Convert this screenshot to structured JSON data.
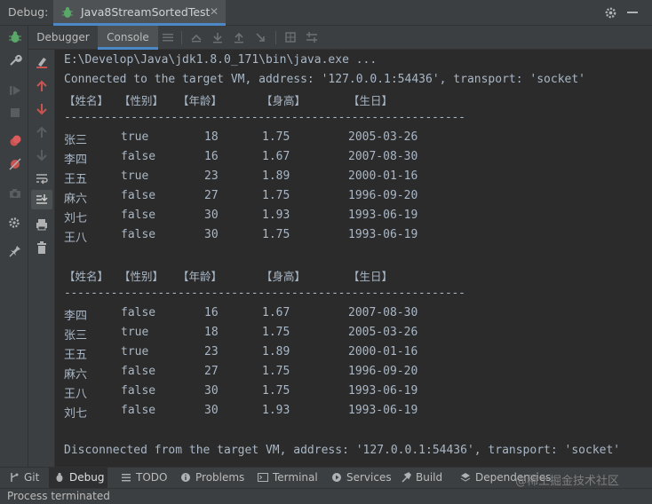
{
  "topbar": {
    "label": "Debug:",
    "session_tab": "Java8StreamSortedTest"
  },
  "tabs": {
    "debugger": "Debugger",
    "console": "Console"
  },
  "console": {
    "command": "E:\\Develop\\Java\\jdk1.8.0_171\\bin\\java.exe ...",
    "connected": "Connected to the target VM, address: '127.0.0.1:54436', transport: 'socket'",
    "headers": [
      "【姓名】",
      "【性别】",
      "【年龄】",
      "【身高】",
      "【生日】"
    ],
    "separator": "------------------------------------------------------------",
    "table1": [
      [
        "张三",
        "true",
        "18",
        "1.75",
        "2005-03-26"
      ],
      [
        "李四",
        "false",
        "16",
        "1.67",
        "2007-08-30"
      ],
      [
        "王五",
        "true",
        "23",
        "1.89",
        "2000-01-16"
      ],
      [
        "麻六",
        "false",
        "27",
        "1.75",
        "1996-09-20"
      ],
      [
        "刘七",
        "false",
        "30",
        "1.93",
        "1993-06-19"
      ],
      [
        "王八",
        "false",
        "30",
        "1.75",
        "1993-06-19"
      ]
    ],
    "table2": [
      [
        "李四",
        "false",
        "16",
        "1.67",
        "2007-08-30"
      ],
      [
        "张三",
        "true",
        "18",
        "1.75",
        "2005-03-26"
      ],
      [
        "王五",
        "true",
        "23",
        "1.89",
        "2000-01-16"
      ],
      [
        "麻六",
        "false",
        "27",
        "1.75",
        "1996-09-20"
      ],
      [
        "王八",
        "false",
        "30",
        "1.75",
        "1993-06-19"
      ],
      [
        "刘七",
        "false",
        "30",
        "1.93",
        "1993-06-19"
      ]
    ],
    "disconnected": "Disconnected from the target VM, address: '127.0.0.1:54436', transport: 'socket'"
  },
  "bottom_tabs": {
    "git": "Git",
    "debug": "Debug",
    "todo": "TODO",
    "problems": "Problems",
    "terminal": "Terminal",
    "services": "Services",
    "build": "Build",
    "dependencies": "Dependencies"
  },
  "status": "Process terminated",
  "watermark": "@稀土掘金技术社区",
  "colors": {
    "accent": "#4a88c7",
    "console_bg": "#2b2b2b",
    "panel_bg": "#3c3f41",
    "text": "#a9b7c6"
  }
}
